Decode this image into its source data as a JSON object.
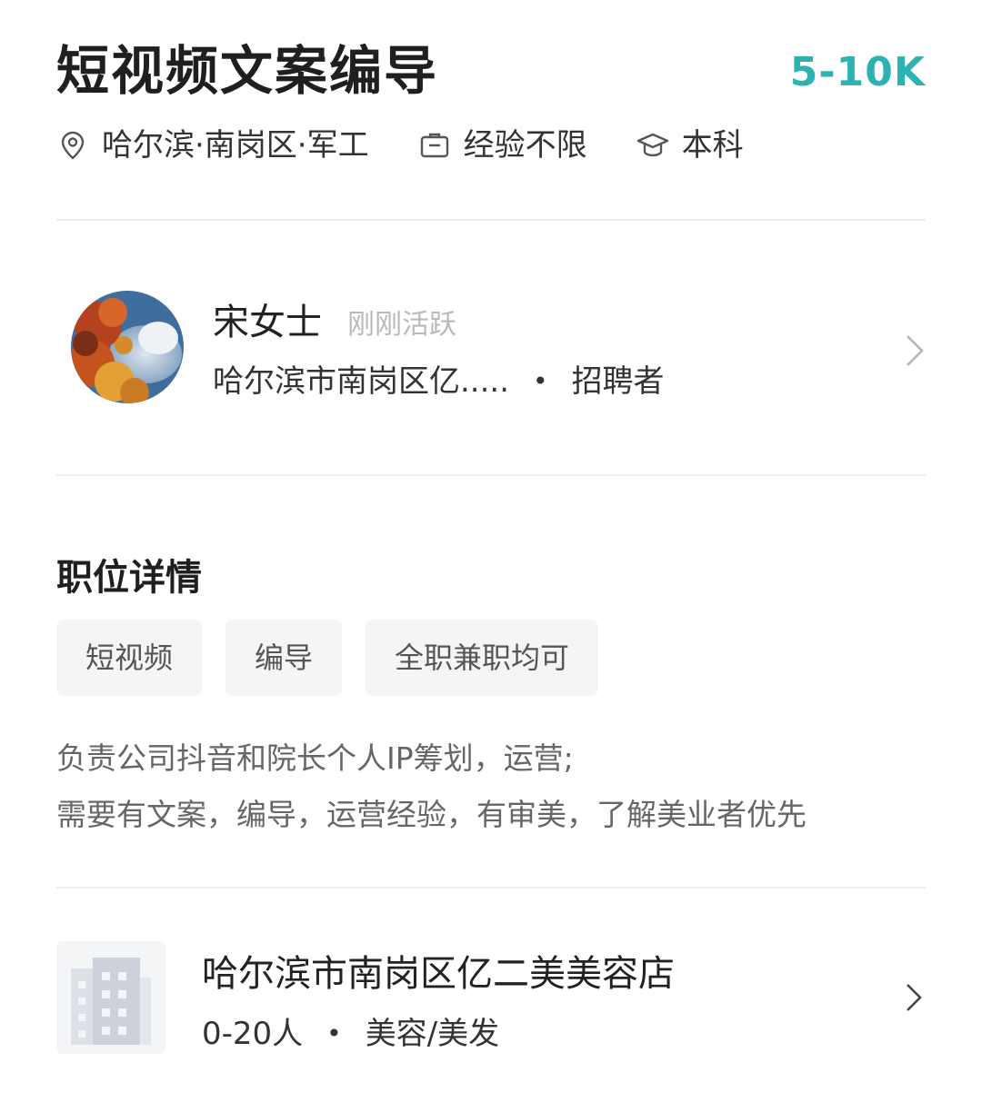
{
  "job": {
    "title": "短视频文案编导",
    "salary": "5-10K",
    "location": "哈尔滨·南岗区·军工",
    "experience": "经验不限",
    "education": "本科"
  },
  "recruiter": {
    "name": "宋女士",
    "status": "刚刚活跃",
    "company_short": "哈尔滨市南岗区亿.....",
    "separator": "•",
    "role": "招聘者"
  },
  "details": {
    "section_title": "职位详情",
    "tags": [
      "短视频",
      "编导",
      "全职兼职均可"
    ],
    "description_lines": [
      "负责公司抖音和院长个人IP筹划，运营;",
      "需要有文案，编导，运营经验，有审美，了解美业者优先"
    ]
  },
  "company": {
    "name": "哈尔滨市南岗区亿二美美容店",
    "size": "0-20人",
    "separator": "•",
    "industry": "美容/美发"
  },
  "colors": {
    "salary": "#2bb3b1",
    "divider": "#eeeeee",
    "tag_bg": "#f5f5f5"
  },
  "icons": {
    "location": "location-pin-icon",
    "experience": "briefcase-icon",
    "education": "graduation-cap-icon",
    "chevron": "chevron-right-icon"
  }
}
